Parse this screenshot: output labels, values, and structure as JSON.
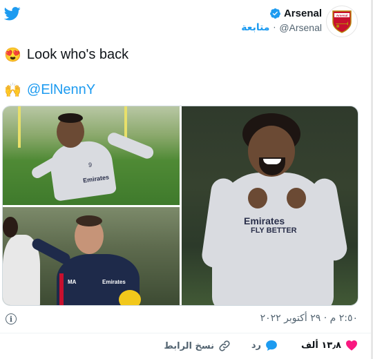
{
  "header": {
    "display_name": "Arsenal",
    "handle": "@Arsenal",
    "separator": "·",
    "follow_label": "متابعة",
    "logo_text": "Arsenal",
    "verified": true
  },
  "tweet": {
    "line1_emoji": "😍",
    "line1_text": "Look who's back",
    "line2_emoji": "🙌",
    "line2_mention": "@ElNennY"
  },
  "media": {
    "photos": [
      {
        "shirt_text": "Emirates",
        "number": "9"
      },
      {
        "shirt_text": "Emirates",
        "jacket_initials": "MA"
      },
      {
        "shirt_text": "Emirates",
        "shirt_text2": "FLY BETTER"
      }
    ]
  },
  "meta": {
    "info_glyph": "i",
    "timestamp": "٢:٥٠ م · ٢٩ أكتوبر ٢٠٢٢"
  },
  "actions": {
    "like_count": "١٣٫٨ ألف",
    "reply_label": "رد",
    "copy_link_label": "نسخ الرابط"
  },
  "colors": {
    "twitter_blue": "#1d9bf0",
    "like_pink": "#f91880",
    "arsenal_red": "#c8102e",
    "text_secondary": "#536471"
  }
}
